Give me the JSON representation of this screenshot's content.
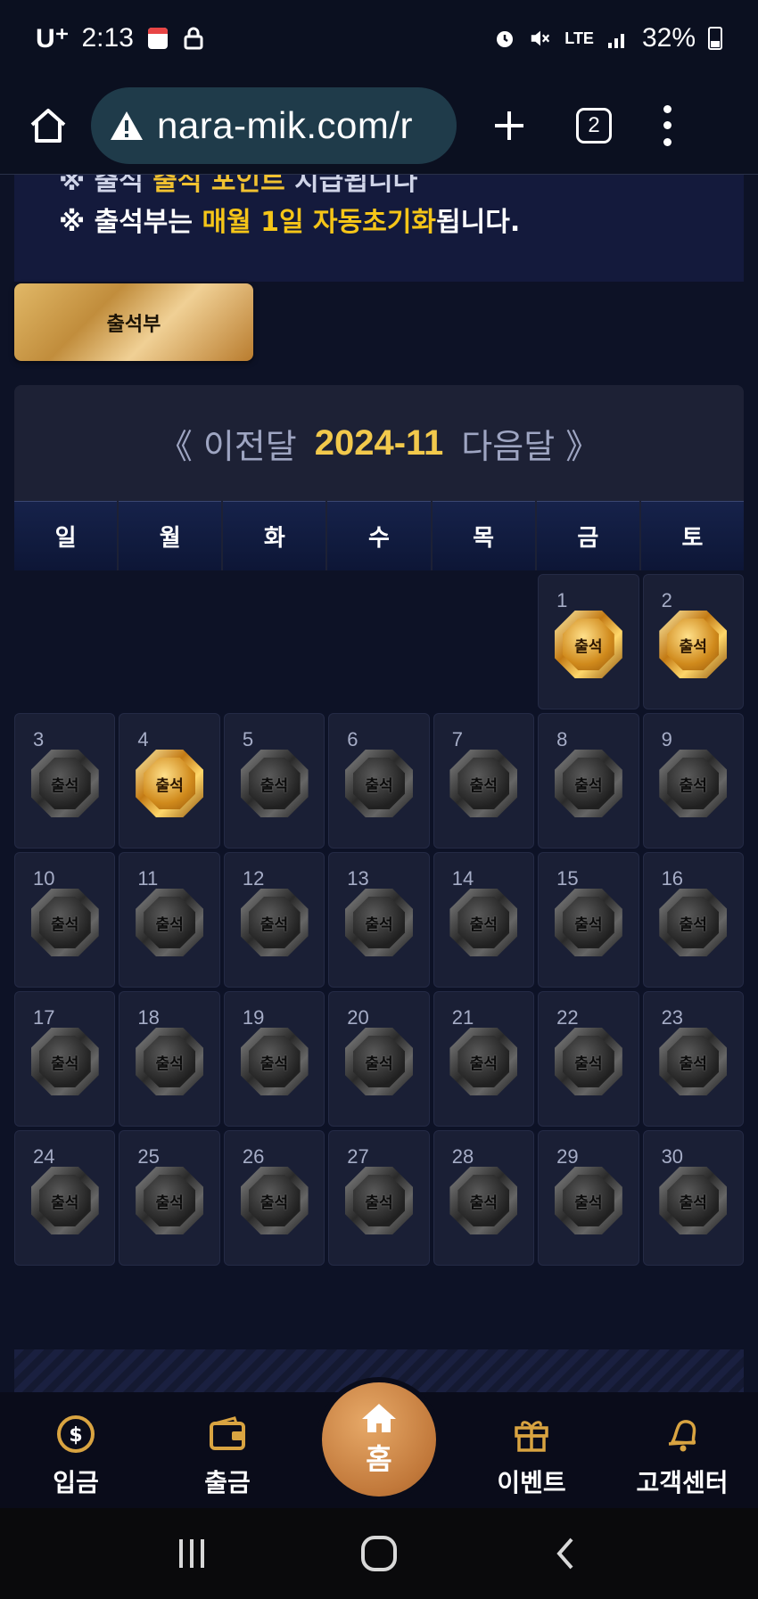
{
  "status_bar": {
    "carrier": "U⁺",
    "time": "2:13",
    "network": "LTE",
    "battery": "32%"
  },
  "browser": {
    "url": "nara-mik.com/r",
    "tab_count": "2"
  },
  "notice": {
    "cut_line_prefix": "※ 출석",
    "cut_line_highlight": "출석 포인트",
    "cut_line_suffix": "지급됩니다",
    "line_prefix": "※ 출석부는 ",
    "line_highlight": "매월 1일 자동초기화",
    "line_suffix": "됩니다."
  },
  "attendance_button": "출석부",
  "calendar": {
    "prev_label": "《 이전달",
    "month": "2024-11",
    "next_label": "다음달 》",
    "weekdays": [
      "일",
      "월",
      "화",
      "수",
      "목",
      "금",
      "토"
    ],
    "badge_text": "출석",
    "leading_blanks": 5,
    "days": [
      {
        "num": "1",
        "attended": true
      },
      {
        "num": "2",
        "attended": true
      },
      {
        "num": "3",
        "attended": false
      },
      {
        "num": "4",
        "attended": true
      },
      {
        "num": "5",
        "attended": false
      },
      {
        "num": "6",
        "attended": false
      },
      {
        "num": "7",
        "attended": false
      },
      {
        "num": "8",
        "attended": false
      },
      {
        "num": "9",
        "attended": false
      },
      {
        "num": "10",
        "attended": false
      },
      {
        "num": "11",
        "attended": false
      },
      {
        "num": "12",
        "attended": false
      },
      {
        "num": "13",
        "attended": false
      },
      {
        "num": "14",
        "attended": false
      },
      {
        "num": "15",
        "attended": false
      },
      {
        "num": "16",
        "attended": false
      },
      {
        "num": "17",
        "attended": false
      },
      {
        "num": "18",
        "attended": false
      },
      {
        "num": "19",
        "attended": false
      },
      {
        "num": "20",
        "attended": false
      },
      {
        "num": "21",
        "attended": false
      },
      {
        "num": "22",
        "attended": false
      },
      {
        "num": "23",
        "attended": false
      },
      {
        "num": "24",
        "attended": false
      },
      {
        "num": "25",
        "attended": false
      },
      {
        "num": "26",
        "attended": false
      },
      {
        "num": "27",
        "attended": false
      },
      {
        "num": "28",
        "attended": false
      },
      {
        "num": "29",
        "attended": false
      },
      {
        "num": "30",
        "attended": false
      }
    ]
  },
  "bottom_nav": {
    "deposit": "입금",
    "withdraw": "출금",
    "home": "홈",
    "event": "이벤트",
    "support": "고객센터"
  },
  "colors": {
    "accent_gold": "#f2c94c",
    "background": "#0d1226",
    "home_button": "#c1783a"
  }
}
